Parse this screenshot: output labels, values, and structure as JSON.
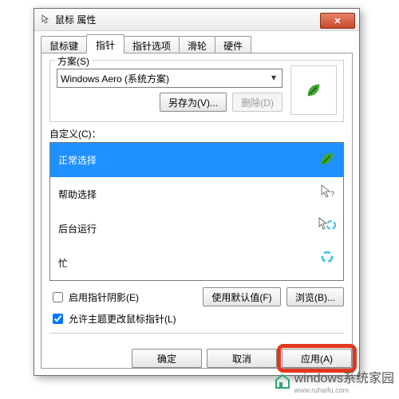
{
  "window": {
    "title": "鼠标 属性"
  },
  "tabs": {
    "buttons": "鼠标键",
    "pointers": "指针",
    "options": "指针选项",
    "wheel": "滑轮",
    "hw": "硬件"
  },
  "scheme": {
    "legend": "方案(S)",
    "value": "Windows Aero (系统方案)",
    "save_as": "另存为(V)...",
    "delete": "删除(D)"
  },
  "custom": {
    "label": "自定义(C)：",
    "items": [
      "正常选择",
      "帮助选择",
      "后台运行",
      "忙"
    ]
  },
  "options": {
    "shadow": "启用指针阴影(E)",
    "theme": "允许主题更改鼠标指针(L)",
    "defaults": "使用默认值(F)",
    "browse": "浏览(B)..."
  },
  "footer": {
    "ok": "确定",
    "cancel": "取消",
    "apply": "应用(A)"
  },
  "watermark": {
    "brand": "windows系统家园",
    "url": "www.ruhaifu.com"
  }
}
